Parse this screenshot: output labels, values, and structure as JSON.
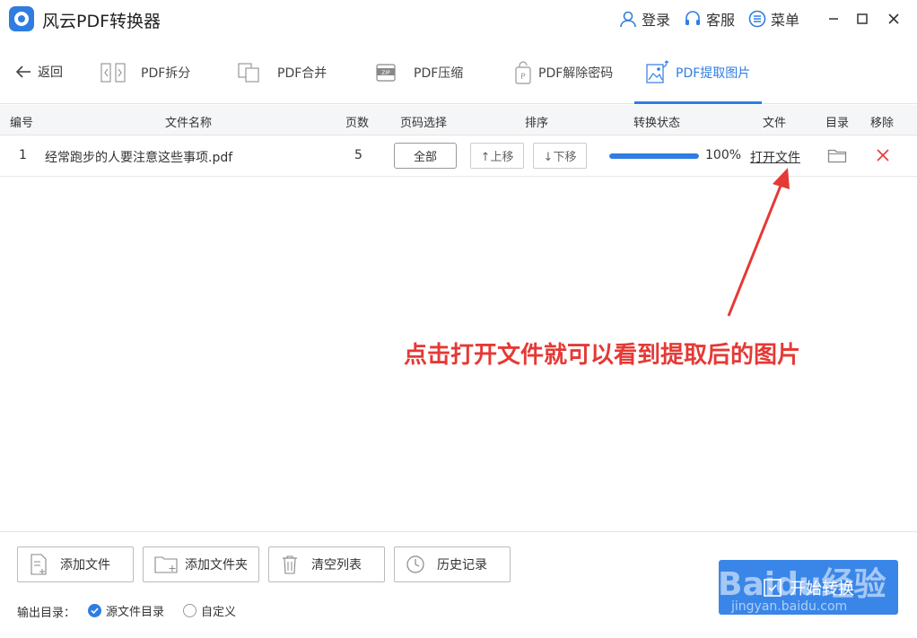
{
  "app": {
    "title": "风云PDF转换器",
    "accent": "#2f7de1"
  },
  "titlebar": {
    "login": "登录",
    "service": "客服",
    "menu": "菜单"
  },
  "toolbar": {
    "back": "返回",
    "tabs": [
      {
        "label": "PDF拆分",
        "icon": "split-icon"
      },
      {
        "label": "PDF合并",
        "icon": "merge-icon"
      },
      {
        "label": "PDF压缩",
        "icon": "zip-icon"
      },
      {
        "label": "PDF解除密码",
        "icon": "unlock-icon"
      },
      {
        "label": "PDF提取图片",
        "icon": "image-extract-icon",
        "active": true
      }
    ]
  },
  "table": {
    "headers": [
      "编号",
      "文件名称",
      "页数",
      "页码选择",
      "排序",
      "转换状态",
      "文件",
      "目录",
      "移除"
    ],
    "rows": [
      {
        "index": "1",
        "filename": "经常跑步的人要注意这些事项.pdf",
        "pages": "5",
        "page_select": "全部",
        "move_up": "↑上移",
        "move_down": "↓下移",
        "progress": 1.0,
        "progress_text": "100%",
        "open_file": "打开文件"
      }
    ]
  },
  "annotation": {
    "text": "点击打开文件就可以看到提取后的图片",
    "color": "#e53935"
  },
  "bottom": {
    "add_file": "添加文件",
    "add_folder": "添加文件夹",
    "clear_list": "清空列表",
    "history": "历史记录",
    "start": "开始转换",
    "output_label": "输出目录：",
    "option_source": "源文件目录",
    "option_custom": "自定义",
    "selected_option": "源文件目录"
  },
  "watermark": {
    "text": "Baidu经验",
    "url": "jingyan.baidu.com"
  }
}
